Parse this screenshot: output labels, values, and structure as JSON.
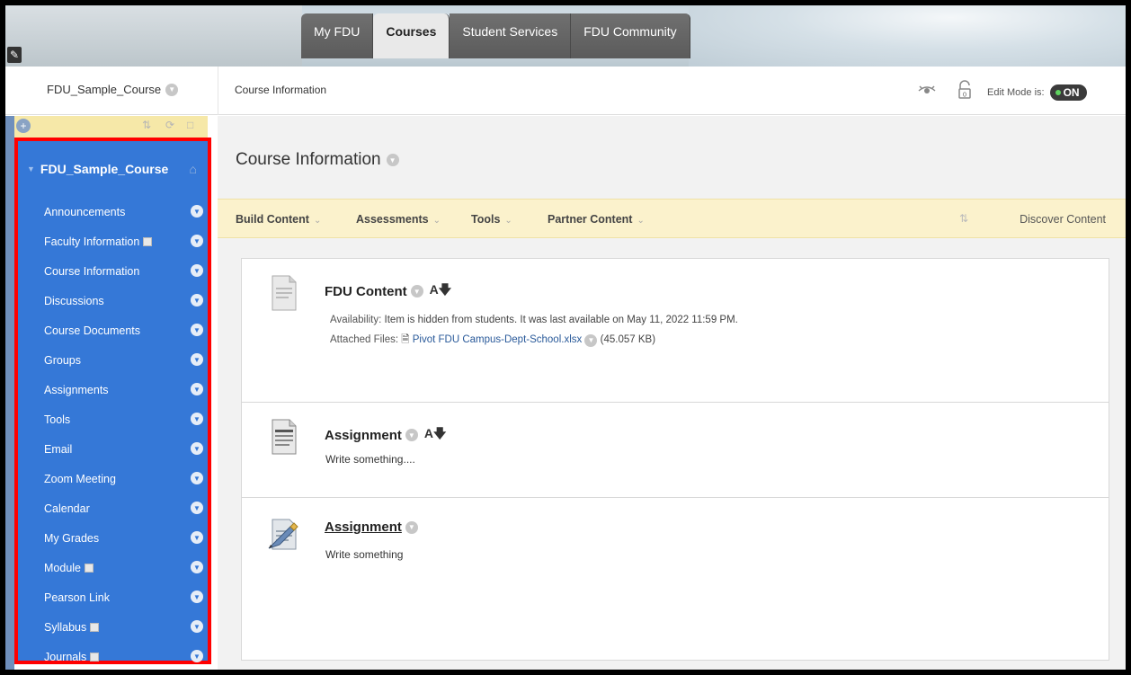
{
  "banner": {
    "tabs": [
      {
        "label": "My FDU",
        "active": false
      },
      {
        "label": "Courses",
        "active": true
      },
      {
        "label": "Student Services",
        "active": false
      },
      {
        "label": "FDU Community",
        "active": false
      }
    ]
  },
  "header": {
    "course_name": "FDU_Sample_Course",
    "breadcrumb": "Course Information",
    "edit_mode_label": "Edit Mode is:",
    "edit_mode_state": "ON",
    "lock_count": "0"
  },
  "sidebar": {
    "title": "FDU_Sample_Course",
    "items": [
      {
        "label": "Announcements"
      },
      {
        "label": "Faculty Information"
      },
      {
        "label": "Course Information"
      },
      {
        "label": "Discussions"
      },
      {
        "label": "Course Documents"
      },
      {
        "label": "Groups"
      },
      {
        "label": "Assignments"
      },
      {
        "label": "Tools"
      },
      {
        "label": "Email"
      },
      {
        "label": "Zoom Meeting"
      },
      {
        "label": "Calendar"
      },
      {
        "label": "My Grades"
      },
      {
        "label": "Module"
      },
      {
        "label": "Pearson Link"
      },
      {
        "label": "Syllabus"
      },
      {
        "label": "Journals"
      }
    ],
    "accent_color": "#3578d7",
    "highlight_border": "#ff0000"
  },
  "main": {
    "page_title": "Course Information",
    "toolbar": {
      "build_content": "Build Content",
      "assessments": "Assessments",
      "tools": "Tools",
      "partner_content": "Partner Content",
      "discover_content": "Discover Content"
    },
    "items": [
      {
        "title": "FDU Content",
        "availability_label": "Availability:",
        "availability_text": "Item is hidden from students. It was last available on May 11, 2022 11:59 PM.",
        "attached_label": "Attached Files:",
        "attached_file": "Pivot FDU Campus-Dept-School.xlsx",
        "attached_size": "(45.057 KB)"
      },
      {
        "title": "Assignment",
        "description": "Write something...."
      },
      {
        "title": "Assignment",
        "description": "Write something"
      }
    ]
  }
}
